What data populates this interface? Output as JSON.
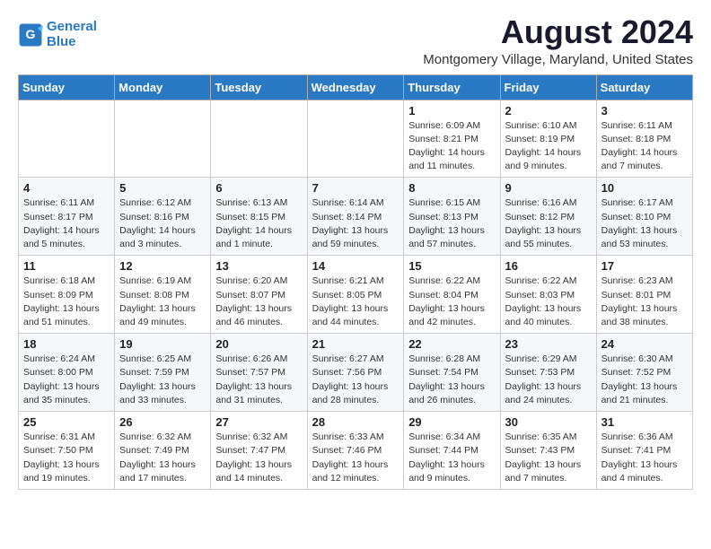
{
  "header": {
    "logo_line1": "General",
    "logo_line2": "Blue",
    "month_title": "August 2024",
    "location": "Montgomery Village, Maryland, United States"
  },
  "weekdays": [
    "Sunday",
    "Monday",
    "Tuesday",
    "Wednesday",
    "Thursday",
    "Friday",
    "Saturday"
  ],
  "weeks": [
    [
      {
        "day": "",
        "info": ""
      },
      {
        "day": "",
        "info": ""
      },
      {
        "day": "",
        "info": ""
      },
      {
        "day": "",
        "info": ""
      },
      {
        "day": "1",
        "info": "Sunrise: 6:09 AM\nSunset: 8:21 PM\nDaylight: 14 hours\nand 11 minutes."
      },
      {
        "day": "2",
        "info": "Sunrise: 6:10 AM\nSunset: 8:19 PM\nDaylight: 14 hours\nand 9 minutes."
      },
      {
        "day": "3",
        "info": "Sunrise: 6:11 AM\nSunset: 8:18 PM\nDaylight: 14 hours\nand 7 minutes."
      }
    ],
    [
      {
        "day": "4",
        "info": "Sunrise: 6:11 AM\nSunset: 8:17 PM\nDaylight: 14 hours\nand 5 minutes."
      },
      {
        "day": "5",
        "info": "Sunrise: 6:12 AM\nSunset: 8:16 PM\nDaylight: 14 hours\nand 3 minutes."
      },
      {
        "day": "6",
        "info": "Sunrise: 6:13 AM\nSunset: 8:15 PM\nDaylight: 14 hours\nand 1 minute."
      },
      {
        "day": "7",
        "info": "Sunrise: 6:14 AM\nSunset: 8:14 PM\nDaylight: 13 hours\nand 59 minutes."
      },
      {
        "day": "8",
        "info": "Sunrise: 6:15 AM\nSunset: 8:13 PM\nDaylight: 13 hours\nand 57 minutes."
      },
      {
        "day": "9",
        "info": "Sunrise: 6:16 AM\nSunset: 8:12 PM\nDaylight: 13 hours\nand 55 minutes."
      },
      {
        "day": "10",
        "info": "Sunrise: 6:17 AM\nSunset: 8:10 PM\nDaylight: 13 hours\nand 53 minutes."
      }
    ],
    [
      {
        "day": "11",
        "info": "Sunrise: 6:18 AM\nSunset: 8:09 PM\nDaylight: 13 hours\nand 51 minutes."
      },
      {
        "day": "12",
        "info": "Sunrise: 6:19 AM\nSunset: 8:08 PM\nDaylight: 13 hours\nand 49 minutes."
      },
      {
        "day": "13",
        "info": "Sunrise: 6:20 AM\nSunset: 8:07 PM\nDaylight: 13 hours\nand 46 minutes."
      },
      {
        "day": "14",
        "info": "Sunrise: 6:21 AM\nSunset: 8:05 PM\nDaylight: 13 hours\nand 44 minutes."
      },
      {
        "day": "15",
        "info": "Sunrise: 6:22 AM\nSunset: 8:04 PM\nDaylight: 13 hours\nand 42 minutes."
      },
      {
        "day": "16",
        "info": "Sunrise: 6:22 AM\nSunset: 8:03 PM\nDaylight: 13 hours\nand 40 minutes."
      },
      {
        "day": "17",
        "info": "Sunrise: 6:23 AM\nSunset: 8:01 PM\nDaylight: 13 hours\nand 38 minutes."
      }
    ],
    [
      {
        "day": "18",
        "info": "Sunrise: 6:24 AM\nSunset: 8:00 PM\nDaylight: 13 hours\nand 35 minutes."
      },
      {
        "day": "19",
        "info": "Sunrise: 6:25 AM\nSunset: 7:59 PM\nDaylight: 13 hours\nand 33 minutes."
      },
      {
        "day": "20",
        "info": "Sunrise: 6:26 AM\nSunset: 7:57 PM\nDaylight: 13 hours\nand 31 minutes."
      },
      {
        "day": "21",
        "info": "Sunrise: 6:27 AM\nSunset: 7:56 PM\nDaylight: 13 hours\nand 28 minutes."
      },
      {
        "day": "22",
        "info": "Sunrise: 6:28 AM\nSunset: 7:54 PM\nDaylight: 13 hours\nand 26 minutes."
      },
      {
        "day": "23",
        "info": "Sunrise: 6:29 AM\nSunset: 7:53 PM\nDaylight: 13 hours\nand 24 minutes."
      },
      {
        "day": "24",
        "info": "Sunrise: 6:30 AM\nSunset: 7:52 PM\nDaylight: 13 hours\nand 21 minutes."
      }
    ],
    [
      {
        "day": "25",
        "info": "Sunrise: 6:31 AM\nSunset: 7:50 PM\nDaylight: 13 hours\nand 19 minutes."
      },
      {
        "day": "26",
        "info": "Sunrise: 6:32 AM\nSunset: 7:49 PM\nDaylight: 13 hours\nand 17 minutes."
      },
      {
        "day": "27",
        "info": "Sunrise: 6:32 AM\nSunset: 7:47 PM\nDaylight: 13 hours\nand 14 minutes."
      },
      {
        "day": "28",
        "info": "Sunrise: 6:33 AM\nSunset: 7:46 PM\nDaylight: 13 hours\nand 12 minutes."
      },
      {
        "day": "29",
        "info": "Sunrise: 6:34 AM\nSunset: 7:44 PM\nDaylight: 13 hours\nand 9 minutes."
      },
      {
        "day": "30",
        "info": "Sunrise: 6:35 AM\nSunset: 7:43 PM\nDaylight: 13 hours\nand 7 minutes."
      },
      {
        "day": "31",
        "info": "Sunrise: 6:36 AM\nSunset: 7:41 PM\nDaylight: 13 hours\nand 4 minutes."
      }
    ]
  ]
}
